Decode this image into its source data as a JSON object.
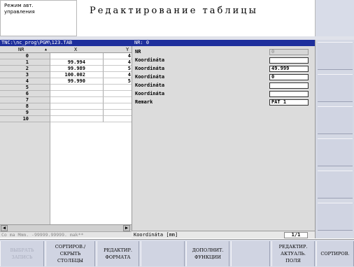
{
  "header": {
    "mode": "Режим авт.\nуправления",
    "title": "Редактирование таблицы"
  },
  "table": {
    "path": "TNC:\\nc_prog\\PGM\\123.TAB",
    "columns": [
      "NR",
      "X",
      "Y"
    ],
    "sort_indicator": "▲",
    "rows": [
      {
        "nr": "0",
        "x": "",
        "y": "4"
      },
      {
        "nr": "1",
        "x": "99.994",
        "y": "4"
      },
      {
        "nr": "2",
        "x": "99.989",
        "y": "5"
      },
      {
        "nr": "3",
        "x": "100.002",
        "y": "4"
      },
      {
        "nr": "4",
        "x": "99.990",
        "y": "5"
      },
      {
        "nr": "5",
        "x": "",
        "y": ""
      },
      {
        "nr": "6",
        "x": "",
        "y": ""
      },
      {
        "nr": "7",
        "x": "",
        "y": ""
      },
      {
        "nr": "8",
        "x": "",
        "y": ""
      },
      {
        "nr": "9",
        "x": "",
        "y": ""
      },
      {
        "nr": "10",
        "x": "",
        "y": ""
      }
    ],
    "limits": "Co ma Mmm. -99999.99999. mak**"
  },
  "form": {
    "header": "NR: 0",
    "fields": [
      {
        "label": "NR",
        "value": "0",
        "readonly": true
      },
      {
        "label": "Koordináta",
        "value": ""
      },
      {
        "label": "Koordináta",
        "value": "49.999"
      },
      {
        "label": "Koordináta",
        "value": "0"
      },
      {
        "label": "Koordináta",
        "value": ""
      },
      {
        "label": "Koordináta",
        "value": ""
      },
      {
        "label": "Remark",
        "value": "PAT 1"
      }
    ],
    "status": "Koordináta [mm]",
    "page": "1/1"
  },
  "softkeys": [
    {
      "label": "ВЫБРАТЬ\nЗАПИСЬ",
      "disabled": true
    },
    {
      "label": "СОРТИРОВ./\nСКРЫТЬ\nСТОЛБЦЫ"
    },
    {
      "label": "РЕДАКТИР.\nФОРМАТА"
    },
    {
      "label": ""
    },
    {
      "label": "ДОПОЛНИТ.\nФУНКЦИИ"
    },
    {
      "label": ""
    },
    {
      "label": "РЕДАКТИР.\nАКТУАЛЬ.\nПОЛЯ"
    },
    {
      "label": "СОРТИРОВ."
    }
  ]
}
